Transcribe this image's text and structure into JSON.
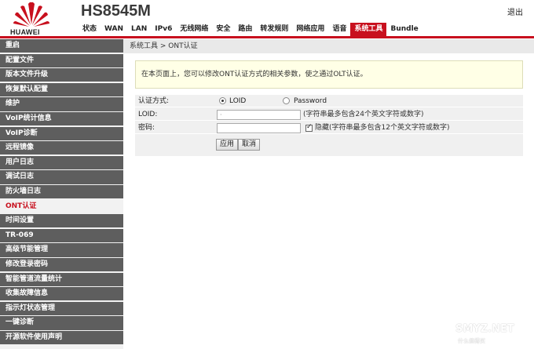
{
  "header": {
    "brand": "HUAWEI",
    "model": "HS8545M",
    "logout": "退出",
    "nav": [
      "状态",
      "WAN",
      "LAN",
      "IPv6",
      "无线网络",
      "安全",
      "路由",
      "转发规则",
      "网络应用",
      "语音",
      "系统工具",
      "Bundle"
    ],
    "active_nav": "系统工具",
    "accent_color": "#c8101e"
  },
  "sidebar": {
    "items": [
      "重启",
      "配置文件",
      "版本文件升级",
      "恢复默认配置",
      "维护",
      "VoIP统计信息",
      "VoIP诊断",
      "远程镜像",
      "用户日志",
      "调试日志",
      "防火墙日志",
      "ONT认证",
      "时间设置",
      "TR-069",
      "高级节能管理",
      "修改登录密码",
      "智能管道流量统计",
      "收集故障信息",
      "指示灯状态管理",
      "一键诊断",
      "开源软件使用声明"
    ],
    "active": "ONT认证"
  },
  "main": {
    "breadcrumb": "系统工具 > ONT认证",
    "notice": "在本页面上，您可以修改ONT认证方式的相关参数，使之通过OLT认证。",
    "form": {
      "auth_label": "认证方式:",
      "auth_options": [
        "LOID",
        "Password"
      ],
      "auth_selected": "LOID",
      "loid_label": "LOID:",
      "loid_value": "·",
      "loid_hint": "(字符串最多包含24个英文字符或数字)",
      "pwd_label": "密码:",
      "pwd_value": "",
      "hide_checked": true,
      "hide_hint": "隐藏(字符串最多包含12个英文字符或数字)",
      "apply": "应用",
      "cancel": "取消"
    }
  },
  "watermark": {
    "text": "SMYZ.NET",
    "sub": "什么值得买"
  }
}
